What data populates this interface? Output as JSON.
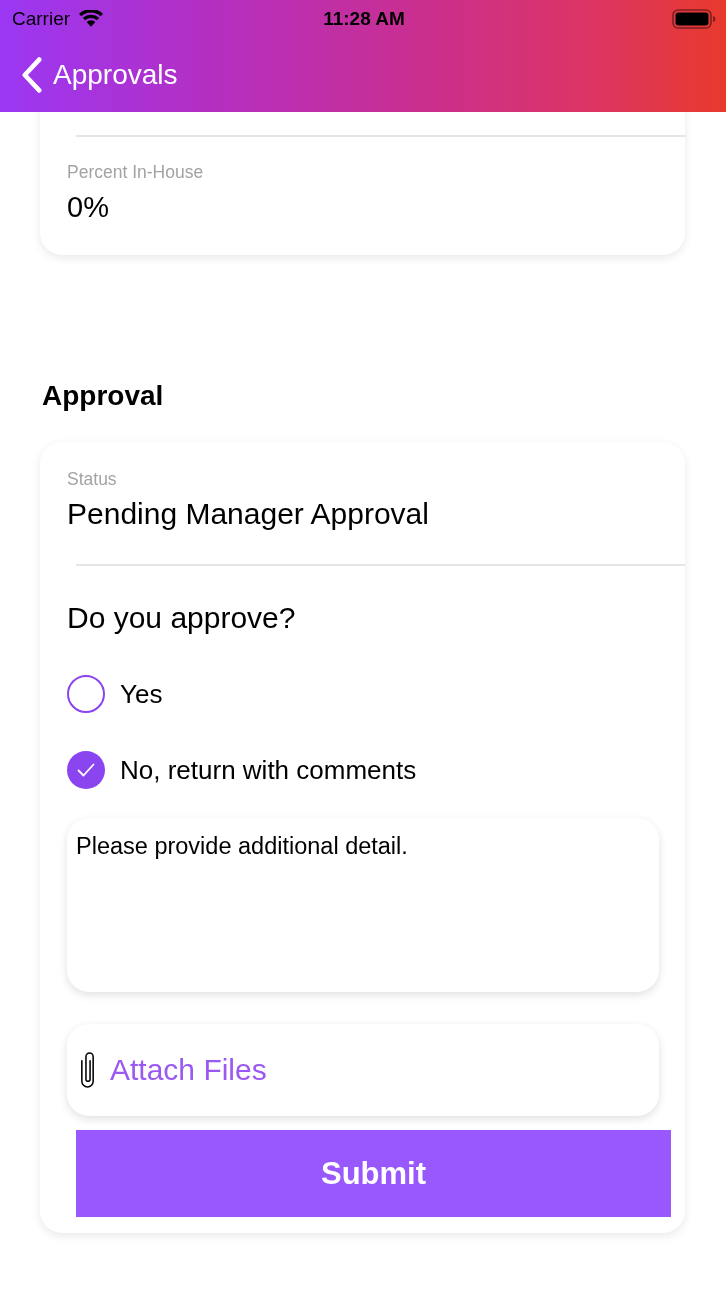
{
  "status_bar": {
    "carrier": "Carrier",
    "time": "11:28 AM"
  },
  "nav_bar": {
    "back_label": "Approvals"
  },
  "details_card": {
    "fields": [
      {
        "label": "Percent In-House",
        "value": "0%"
      }
    ]
  },
  "approval": {
    "heading": "Approval",
    "status": {
      "label": "Status",
      "value": "Pending Manager Approval"
    },
    "question": "Do you approve?",
    "options": [
      {
        "label": "Yes",
        "selected": false
      },
      {
        "label": "No, return with comments",
        "selected": true
      }
    ],
    "comments": {
      "value": "Please provide additional detail."
    },
    "attach": {
      "label": "Attach Files"
    },
    "submit": {
      "label": "Submit"
    }
  }
}
